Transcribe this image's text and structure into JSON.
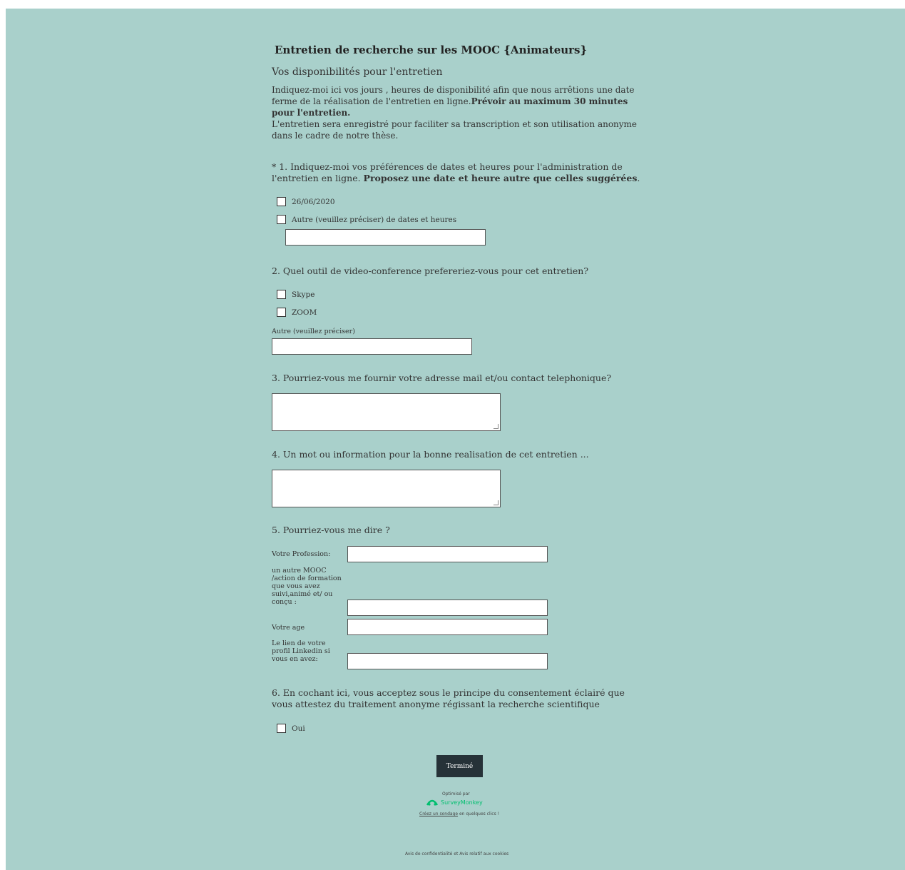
{
  "survey": {
    "title": "Entretien de recherche sur les MOOC {Animateurs}",
    "page_title": "Vos disponibilités pour  l'entretien",
    "intro_line1": "Indiquez-moi ici  vos  jours , heures de disponibilité afin que  nous arrêtions  une date ferme de  la réalisation de  l'entretien en  ligne.",
    "intro_bold": "Prévoir au maximum 30 minutes pour l'entretien.",
    "intro_line2": "L'entretien sera enregistré pour faciliter sa transcription et  son  utilisation anonyme dans le cadre de  notre thèse."
  },
  "q1": {
    "text": "* 1. Indiquez-moi  vos  préférences  de  dates et  heures pour  l'administration de  l'entretien en  ligne. ",
    "bold": "Proposez une date  et heure autre que  celles  suggérées",
    "tail": ".",
    "options": [
      "26/06/2020",
      "Autre (veuillez préciser) de dates et  heures"
    ]
  },
  "q2": {
    "text": "2. Quel outil de video-conference prefereriez-vous  pour cet entretien?",
    "options": [
      "Skype",
      "ZOOM"
    ],
    "other_label": "Autre (veuillez préciser)"
  },
  "q3": {
    "text": "3. Pourriez-vous me  fournir  votre adresse  mail  et/ou contact telephonique?"
  },
  "q4": {
    "text": "4. Un mot ou information pour  la  bonne realisation de cet entretien ..."
  },
  "q5": {
    "text": "5. Pourriez-vous me dire ?",
    "fields": [
      "Votre Profession:",
      "un autre MOOC /action de formation que vous avez suivi,animé et/ ou conçu :",
      "Votre age",
      "Le lien de votre  profil Linkedin si vous en avez:"
    ]
  },
  "q6": {
    "text": "6. En cochant ici, vous  acceptez sous le  principe du  consentement éclairé que vous attestez du  traitement  anonyme régissant  la recherche  scientifique",
    "option": "Oui"
  },
  "footer": {
    "done_label": "Terminé",
    "powered_by": "Optimisé par",
    "brand": "SurveyMonkey",
    "create_link": "Créez un sondage",
    "create_tail": " en quelques clics !",
    "privacy": "Avis de confidentialité et Avis relatif aux cookies"
  },
  "colors": {
    "background": "#a9d0cb",
    "button": "#263238",
    "brand_green": "#00bf6f"
  }
}
